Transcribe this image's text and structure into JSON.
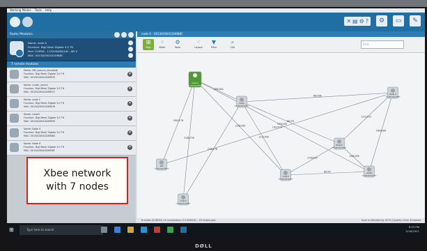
{
  "menubar": {
    "items": [
      "Working Modes",
      "Tools",
      "Help"
    ]
  },
  "header": {
    "buttons": [
      "x-icon",
      "doc-icon",
      "gear-icon",
      "help-icon",
      "settings-icon",
      "monitor-icon",
      "wrench-icon"
    ]
  },
  "left_panel": {
    "title": "Radio Modules",
    "local_radio": {
      "name": "Name: node A",
      "function": "Function: Digi Mesh Zigbee 3.0 TH",
      "port": "Port: COM36 - 115200/8/N/1/N - API 2",
      "mac": "MAC: 0013A20041D49B8C"
    },
    "remote_title": "7 remote modules",
    "devices": [
      {
        "name": "Name: DB (ground_elevated)",
        "function": "Function: Digi Mesh Zigbee 3.0 TH",
        "mac": "MAC: 0013A20041D49B7E"
      },
      {
        "name": "Name: router_sound",
        "function": "Function: Digi Mesh Zigbee 3.0 TH",
        "mac": "MAC: 0013A20041D49B71"
      },
      {
        "name": "Name: node 2",
        "function": "Function: Digi Mesh Zigbee 3.0 TH",
        "mac": "MAC: 0013A20041D49B76"
      },
      {
        "name": "Name: node3",
        "function": "Function: Digi Mesh Zigbee 3.0 TH",
        "mac": "MAC: 0013A20041D49B93"
      },
      {
        "name": "Name: Node 4",
        "function": "Function: Digi Mesh Zigbee 3.0 TH",
        "mac": "MAC: 0013A20041D49B84"
      },
      {
        "name": "Name: Node 6",
        "function": "Function: Digi Mesh Zigbee 3.0 TH",
        "mac": "MAC: 0013A20041D49B6F"
      }
    ]
  },
  "main": {
    "tab": "node A - 0013A20041D49B8C",
    "toolbar": [
      "Map",
      "Mesh",
      "Tools",
      "Layout",
      "Filter"
    ],
    "zoom": "100",
    "search_placeholder": "Find...",
    "status_left": "8 nodes (8 MESH) 13 connections (13 VISIBLE) - 16 Challenges",
    "status_right": "Scan to Monitoring: XCTU (Quality) Scan Accepted",
    "nodes": [
      {
        "label": "node A",
        "mac": "0013A20041D49B8C",
        "coordinator": true
      },
      {
        "label": "router",
        "mac": "0013A20041D49B71",
        "coordinator": false
      },
      {
        "label": "node 2",
        "mac": "0013A20041D49B76",
        "coordinator": false
      },
      {
        "label": "node3",
        "mac": "0013A20041D49B93",
        "coordinator": false
      },
      {
        "label": "Node 4",
        "mac": "0013A20041D49B84",
        "coordinator": false
      },
      {
        "label": "Node 6",
        "mac": "0013A20041D49B6F",
        "coordinator": false
      },
      {
        "label": "DB",
        "mac": "0013A20041D49B7E",
        "coordinator": false
      },
      {
        "label": "node 5",
        "mac": "0013A20041D49BA1",
        "coordinator": false
      }
    ],
    "edges": [
      {
        "from": 0,
        "to": 1,
        "label": "189/164"
      },
      {
        "from": 0,
        "to": 2,
        "label": "216/200"
      },
      {
        "from": 0,
        "to": 3,
        "label": "193/205"
      },
      {
        "from": 0,
        "to": 6,
        "label": "200/176"
      },
      {
        "from": 0,
        "to": 7,
        "label": "228/176"
      },
      {
        "from": 1,
        "to": 2,
        "label": "112/108"
      },
      {
        "from": 1,
        "to": 4,
        "label": "96/108"
      },
      {
        "from": 1,
        "to": 5,
        "label": "80/79"
      },
      {
        "from": 2,
        "to": 5,
        "label": "216/200"
      },
      {
        "from": 3,
        "to": 4,
        "label": "164/189"
      },
      {
        "from": 3,
        "to": 5,
        "label": "145/156"
      },
      {
        "from": 4,
        "to": 5,
        "label": "112/119"
      },
      {
        "from": 6,
        "to": 4,
        "label": "132/124"
      },
      {
        "from": 7,
        "to": 1,
        "label": "228/176"
      },
      {
        "from": 2,
        "to": 3,
        "label": "85/92"
      }
    ]
  },
  "taskbar": {
    "search": "Type here to search",
    "clock_time": "8:53 PM",
    "clock_date": "5/16/2021"
  },
  "monitor_brand": "DØLL",
  "annotation": {
    "line1": "Xbee network",
    "line2": "with 7 nodes"
  }
}
